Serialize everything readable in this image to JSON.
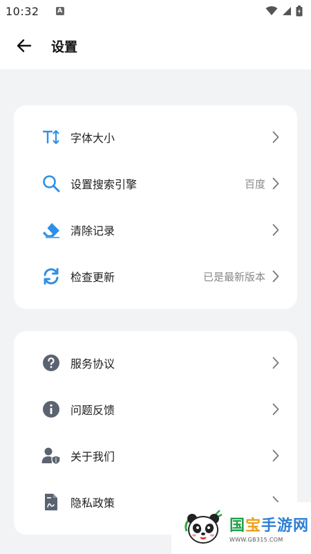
{
  "status_bar": {
    "time": "10:32",
    "notification_glyph": "A",
    "icons": [
      "wifi-icon",
      "signal-icon",
      "battery-icon"
    ]
  },
  "app_bar": {
    "title": "设置",
    "back_icon": "arrow-left-icon"
  },
  "group1": {
    "items": [
      {
        "label": "字体大小",
        "value": "",
        "icon": "font-size-icon",
        "icon_color": "#2f8fe6"
      },
      {
        "label": "设置搜索引擎",
        "value": "百度",
        "icon": "search-icon",
        "icon_color": "#2f8fe6"
      },
      {
        "label": "清除记录",
        "value": "",
        "icon": "eraser-icon",
        "icon_color": "#2f8fe6"
      },
      {
        "label": "检查更新",
        "value": "已是最新版本",
        "icon": "refresh-icon",
        "icon_color": "#2f8fe6"
      }
    ]
  },
  "group2": {
    "items": [
      {
        "label": "服务协议",
        "value": "",
        "icon": "question-circle-icon",
        "icon_color": "#5c6370"
      },
      {
        "label": "问题反馈",
        "value": "",
        "icon": "info-circle-icon",
        "icon_color": "#5c6370"
      },
      {
        "label": "关于我们",
        "value": "",
        "icon": "user-shield-icon",
        "icon_color": "#5c6370"
      },
      {
        "label": "隐私政策",
        "value": "",
        "icon": "document-icon",
        "icon_color": "#5c6370"
      }
    ]
  },
  "watermark": {
    "title_part1": "国",
    "title_part2": "宝",
    "title_part3": "手游网",
    "url": "WWW.GB315.COM"
  },
  "colors": {
    "accent": "#2f8fe6",
    "secondary_icon": "#5c6370",
    "background": "#f2f3f5"
  }
}
